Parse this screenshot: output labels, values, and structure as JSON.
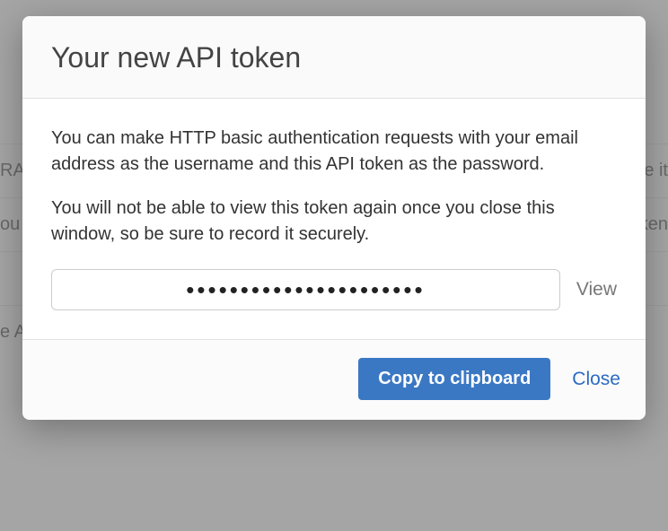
{
  "background": {
    "row1_left": "RA",
    "row1_right": "e it",
    "row2_left": "ou",
    "row2_right": "token",
    "row3_left": "e A"
  },
  "modal": {
    "title": "Your new API token",
    "paragraph1": "You can make HTTP basic authentication requests with your email address as the username and this API token as the password.",
    "paragraph2": "You will not be able to view this token again once you close this window, so be sure to record it securely.",
    "token_masked": "••••••••••••••••••••••",
    "view_label": "View",
    "copy_label": "Copy to clipboard",
    "close_label": "Close"
  }
}
